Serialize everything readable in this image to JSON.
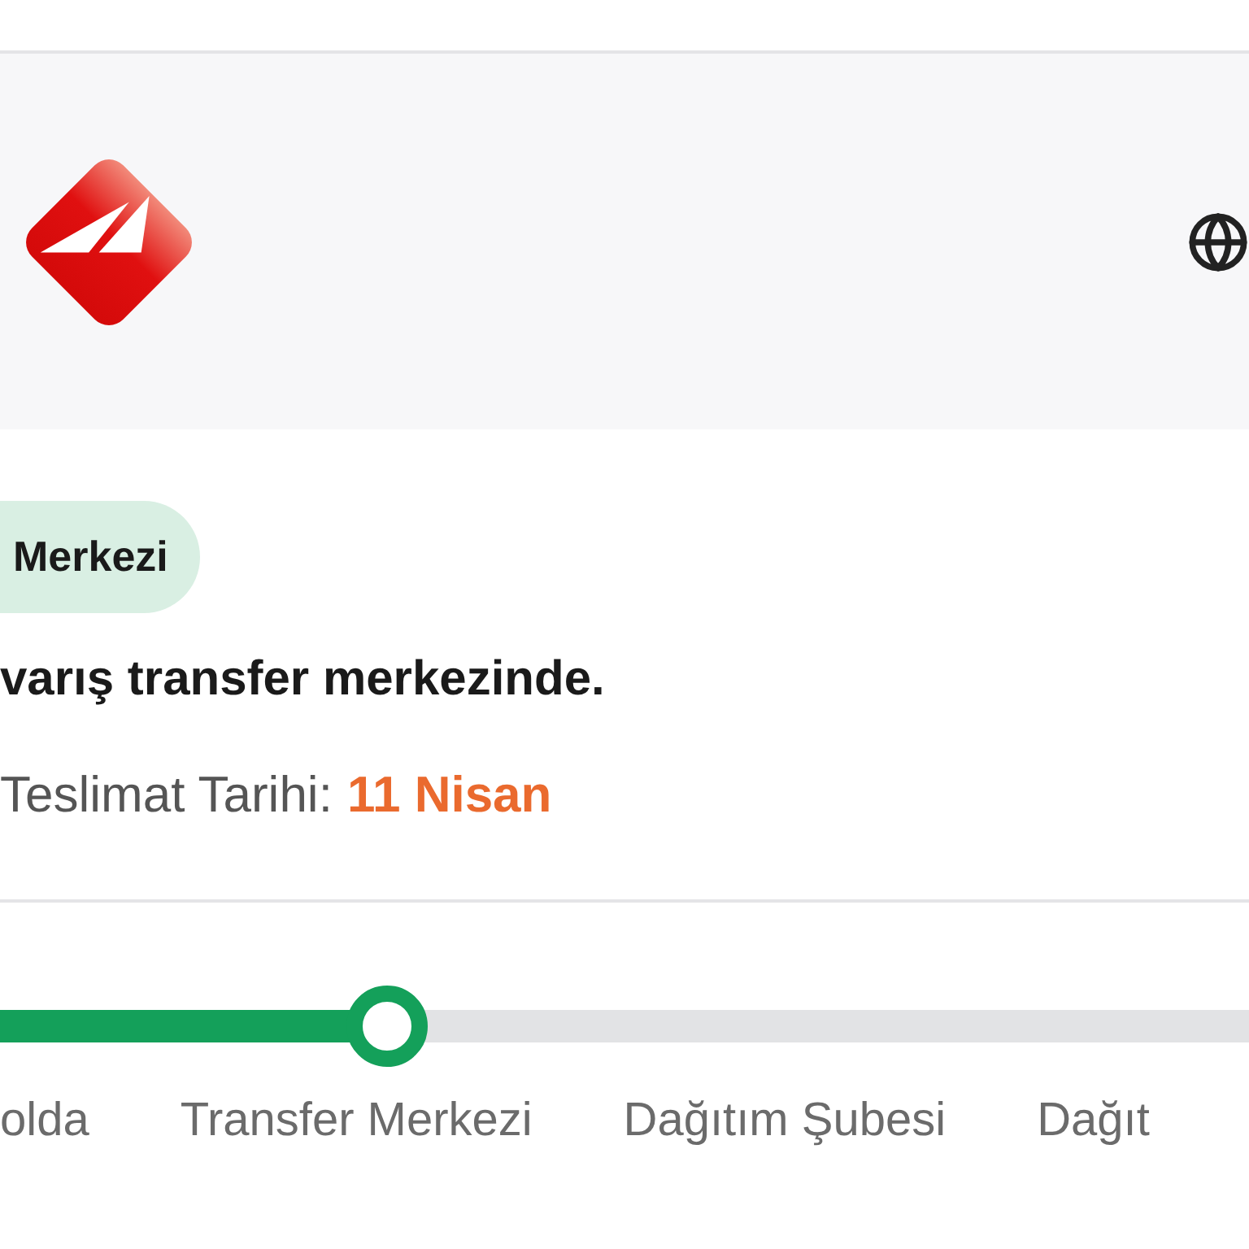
{
  "status_badge": "Merkezi",
  "status_message": "varış transfer merkezinde.",
  "delivery": {
    "label": "Teslimat Tarihi:",
    "value": "11 Nisan"
  },
  "progress": {
    "level": 0.31,
    "steps": [
      "olda",
      "Transfer Merkezi",
      "Dağıtım Şubesi",
      "Dağıt"
    ]
  }
}
